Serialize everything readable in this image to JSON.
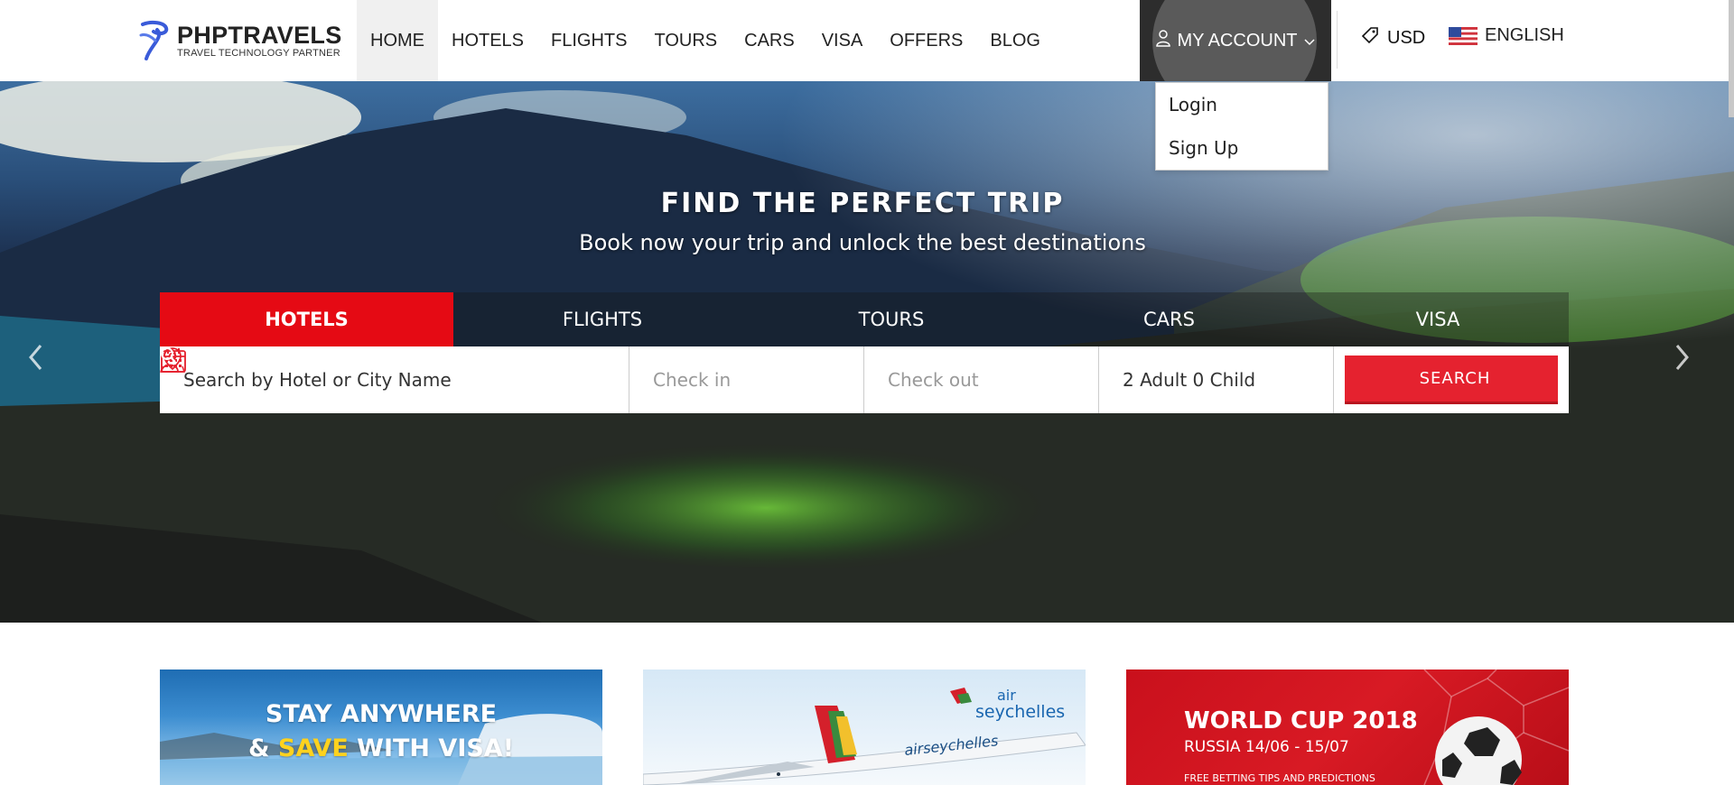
{
  "brand": {
    "name": "PHPTRAVELS",
    "tagline": "TRAVEL TECHNOLOGY PARTNER"
  },
  "nav": {
    "items": [
      {
        "label": "HOME",
        "active": true
      },
      {
        "label": "HOTELS"
      },
      {
        "label": "FLIGHTS"
      },
      {
        "label": "TOURS"
      },
      {
        "label": "CARS"
      },
      {
        "label": "VISA"
      },
      {
        "label": "OFFERS"
      },
      {
        "label": "BLOG"
      }
    ]
  },
  "account": {
    "label": "MY ACCOUNT",
    "menu": [
      "Login",
      "Sign Up"
    ]
  },
  "currency": "USD",
  "language": "ENGLISH",
  "hero": {
    "title": "FIND THE PERFECT TRIP",
    "subtitle": "Book now your trip and unlock the best destinations",
    "tabs": [
      "HOTELS",
      "FLIGHTS",
      "TOURS",
      "CARS",
      "VISA"
    ],
    "active_tab": "HOTELS",
    "search": {
      "destination_placeholder": "Search by Hotel or City Name",
      "checkin_placeholder": "Check in",
      "checkout_placeholder": "Check out",
      "guests": "2 Adult 0 Child",
      "button": "SEARCH"
    }
  },
  "promos": [
    {
      "line1": "STAY ANYWHERE",
      "line2_prefix": "& ",
      "line2_highlight": "SAVE",
      "line2_suffix": " WITH VISA!"
    },
    {
      "brand_top": "air",
      "brand_bottom": "seychelles",
      "livery": "airseychelles"
    },
    {
      "title": "WORLD CUP 2018",
      "subtitle": "RUSSIA 14/06 - 15/07",
      "footer": "FREE BETTING TIPS AND PREDICTIONS"
    }
  ],
  "colors": {
    "accent": "#e50a14",
    "search_button": "#e5222f",
    "account_bg": "#2d2d2d"
  },
  "icons": [
    "account-icon",
    "chevron-down-icon",
    "currency-tag-icon",
    "us-flag-icon",
    "map-pin-icon",
    "calendar-icon",
    "user-icon",
    "search-icon",
    "chevron-left-icon",
    "chevron-right-icon"
  ]
}
